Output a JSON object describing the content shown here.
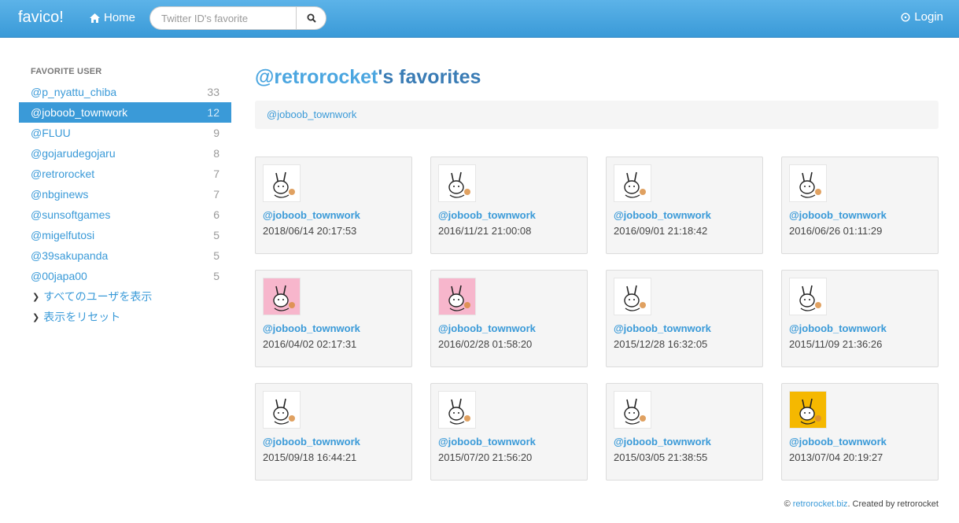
{
  "navbar": {
    "brand": "favico!",
    "home_label": "Home",
    "search_placeholder": "Twitter ID's favorite",
    "login_label": "Login",
    "search_icon": "search-icon",
    "home_icon": "home-icon",
    "login_icon": "power-icon"
  },
  "sidebar": {
    "header": "FAVORITE USER",
    "users": [
      {
        "name": "@p_nyattu_chiba",
        "count": "33"
      },
      {
        "name": "@joboob_townwork",
        "count": "12",
        "active": true
      },
      {
        "name": "@FLUU",
        "count": "9"
      },
      {
        "name": "@gojarudegojaru",
        "count": "8"
      },
      {
        "name": "@retrorocket",
        "count": "7"
      },
      {
        "name": "@nbginews",
        "count": "7"
      },
      {
        "name": "@sunsoftgames",
        "count": "6"
      },
      {
        "name": "@migelfutosi",
        "count": "5"
      },
      {
        "name": "@39sakupanda",
        "count": "5"
      },
      {
        "name": "@00japa00",
        "count": "5"
      }
    ],
    "links": [
      {
        "label": "すべてのユーザを表示"
      },
      {
        "label": "表示をリセット"
      }
    ]
  },
  "main": {
    "title_handle": "@retrorocket",
    "title_suffix": "'s favorites",
    "filter": "@joboob_townwork",
    "cards": [
      {
        "user": "@joboob_townwork",
        "date": "2018/06/14 20:17:53",
        "bg": "#ffffff"
      },
      {
        "user": "@joboob_townwork",
        "date": "2016/11/21 21:00:08",
        "bg": "#ffffff"
      },
      {
        "user": "@joboob_townwork",
        "date": "2016/09/01 21:18:42",
        "bg": "#ffffff"
      },
      {
        "user": "@joboob_townwork",
        "date": "2016/06/26 01:11:29",
        "bg": "#ffffff"
      },
      {
        "user": "@joboob_townwork",
        "date": "2016/04/02 02:17:31",
        "bg": "#f7b6cc"
      },
      {
        "user": "@joboob_townwork",
        "date": "2016/02/28 01:58:20",
        "bg": "#f7b6cc"
      },
      {
        "user": "@joboob_townwork",
        "date": "2015/12/28 16:32:05",
        "bg": "#ffffff"
      },
      {
        "user": "@joboob_townwork",
        "date": "2015/11/09 21:36:26",
        "bg": "#ffffff"
      },
      {
        "user": "@joboob_townwork",
        "date": "2015/09/18 16:44:21",
        "bg": "#ffffff"
      },
      {
        "user": "@joboob_townwork",
        "date": "2015/07/20 21:56:20",
        "bg": "#ffffff"
      },
      {
        "user": "@joboob_townwork",
        "date": "2015/03/05 21:38:55",
        "bg": "#ffffff"
      },
      {
        "user": "@joboob_townwork",
        "date": "2013/07/04 20:19:27",
        "bg": "#f5b800"
      }
    ]
  },
  "footer": {
    "copyright": "©",
    "site": "retrorocket.biz",
    "credit": ". Created by retrorocket"
  },
  "colors": {
    "accent": "#3a9ad8",
    "navbar": "#4ba6e0"
  }
}
